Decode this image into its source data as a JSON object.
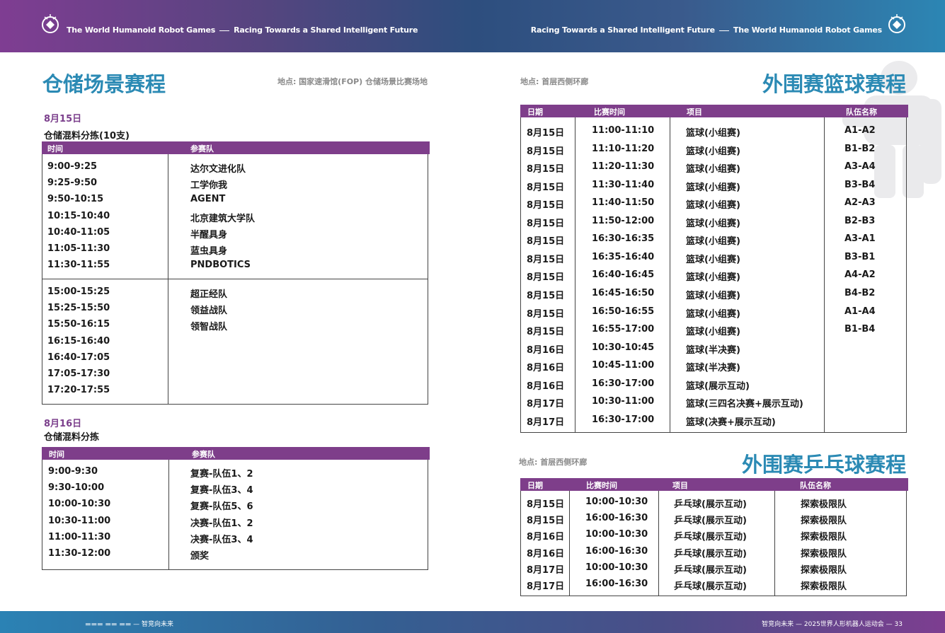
{
  "header": {
    "left_line": [
      "The World Humanoid Robot Games",
      "Racing Towards a Shared Intelligent Future"
    ],
    "right_line": [
      "Racing Towards a Shared Intelligent Future",
      "The World Humanoid Robot Games"
    ]
  },
  "footer": {
    "left_label": "智竞向未来",
    "right_label": "智竞向未来",
    "right_event": "2025世界人形机器人运动会",
    "page_number": "33"
  },
  "warehouse": {
    "title": "仓储场景赛程",
    "venue": "地点: 国家速滑馆(FOP) 仓储场景比赛场地",
    "day1": {
      "date": "8月15日",
      "subtitle": "仓储混料分拣(10支)",
      "headers": [
        "时间",
        "参赛队"
      ],
      "morning_times": [
        "9:00-9:25",
        "9:25-9:50",
        "9:50-10:15",
        "10:15-10:40",
        "10:40-11:05",
        "11:05-11:30",
        "11:30-11:55"
      ],
      "morning_teams": [
        "达尔文进化队",
        "工学你我",
        "AGENT",
        "北京建筑大学队",
        "半醒具身",
        "蓝虫具身",
        "PNDBOTICS"
      ],
      "afternoon_times": [
        "15:00-15:25",
        "15:25-15:50",
        "15:50-16:15",
        "16:15-16:40",
        "16:40-17:05",
        "17:05-17:30",
        "17:20-17:55"
      ],
      "afternoon_teams": [
        "超正经队",
        "领益战队",
        "领智战队"
      ]
    },
    "day2": {
      "date": "8月16日",
      "subtitle": "仓储混料分拣",
      "headers": [
        "时间",
        "参赛队"
      ],
      "times": [
        "9:00-9:30",
        "9:30-10:00",
        "10:00-10:30",
        "10:30-11:00",
        "11:00-11:30",
        "11:30-12:00"
      ],
      "teams": [
        "复赛-队伍1、2",
        "复赛-队伍3、4",
        "复赛-队伍5、6",
        "决赛-队伍1、2",
        "决赛-队伍3、4",
        "颁奖"
      ]
    }
  },
  "basketball": {
    "title": "外围赛篮球赛程",
    "venue": "地点: 首层西侧环廊",
    "headers": [
      "日期",
      "比赛时间",
      "项目",
      "队伍名称"
    ],
    "rows": [
      [
        "8月15日",
        "11:00-11:10",
        "篮球(小组赛)",
        "A1-A2"
      ],
      [
        "8月15日",
        "11:10-11:20",
        "篮球(小组赛)",
        "B1-B2"
      ],
      [
        "8月15日",
        "11:20-11:30",
        "篮球(小组赛)",
        "A3-A4"
      ],
      [
        "8月15日",
        "11:30-11:40",
        "篮球(小组赛)",
        "B3-B4"
      ],
      [
        "8月15日",
        "11:40-11:50",
        "篮球(小组赛)",
        "A2-A3"
      ],
      [
        "8月15日",
        "11:50-12:00",
        "篮球(小组赛)",
        "B2-B3"
      ],
      [
        "8月15日",
        "16:30-16:35",
        "篮球(小组赛)",
        "A3-A1"
      ],
      [
        "8月15日",
        "16:35-16:40",
        "篮球(小组赛)",
        "B3-B1"
      ],
      [
        "8月15日",
        "16:40-16:45",
        "篮球(小组赛)",
        "A4-A2"
      ],
      [
        "8月15日",
        "16:45-16:50",
        "篮球(小组赛)",
        "B4-B2"
      ],
      [
        "8月15日",
        "16:50-16:55",
        "篮球(小组赛)",
        "A1-A4"
      ],
      [
        "8月15日",
        "16:55-17:00",
        "篮球(小组赛)",
        "B1-B4"
      ],
      [
        "8月16日",
        "10:30-10:45",
        "篮球(半决赛)",
        ""
      ],
      [
        "8月16日",
        "10:45-11:00",
        "篮球(半决赛)",
        ""
      ],
      [
        "8月16日",
        "16:30-17:00",
        "篮球(展示互动)",
        ""
      ],
      [
        "8月17日",
        "10:30-11:00",
        "篮球(三四名决赛+展示互动)",
        ""
      ],
      [
        "8月17日",
        "16:30-17:00",
        "篮球(决赛+展示互动)",
        ""
      ]
    ]
  },
  "pingpong": {
    "title": "外围赛乒乓球赛程",
    "venue": "地点: 首层西侧环廊",
    "headers": [
      "日期",
      "比赛时间",
      "项目",
      "队伍名称"
    ],
    "rows": [
      [
        "8月15日",
        "10:00-10:30",
        "乒乓球(展示互动)",
        "探索极限队"
      ],
      [
        "8月15日",
        "16:00-16:30",
        "乒乓球(展示互动)",
        "探索极限队"
      ],
      [
        "8月16日",
        "10:00-10:30",
        "乒乓球(展示互动)",
        "探索极限队"
      ],
      [
        "8月16日",
        "16:00-16:30",
        "乒乓球(展示互动)",
        "探索极限队"
      ],
      [
        "8月17日",
        "10:00-10:30",
        "乒乓球(展示互动)",
        "探索极限队"
      ],
      [
        "8月17日",
        "16:00-16:30",
        "乒乓球(展示互动)",
        "探索极限队"
      ]
    ]
  },
  "icons": [
    "robot-games-logo-icon",
    "robot-silhouette-icon"
  ],
  "colors": {
    "accent_blue": "#2b8ab4",
    "header_purple": "#7e3e8a",
    "date_purple": "#7b3f8c"
  }
}
